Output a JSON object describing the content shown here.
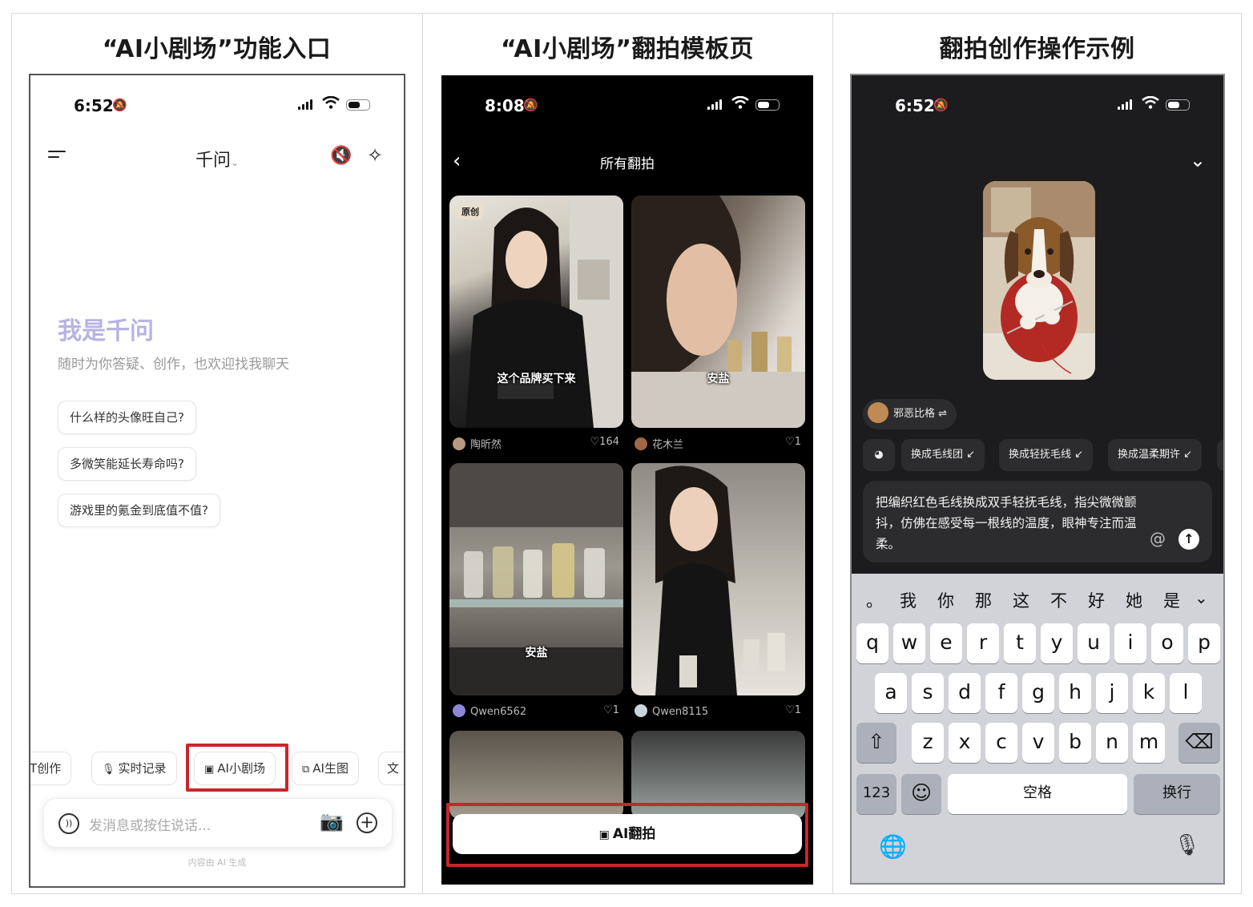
{
  "titles": [
    "“AI小剧场”功能入口",
    "“AI小剧场”翻拍模板页",
    "翻拍创作操作示例"
  ],
  "phone1": {
    "time": "6:52",
    "header_title": "千问",
    "greeting": "我是千问",
    "subtitle": "随时为你答疑、创作，也欢迎找我聊天",
    "suggestions": [
      "什么样的头像旺自己?",
      "多微笑能延长寿命吗?",
      "游戏里的氪金到底值不值?"
    ],
    "tools": [
      "PT创作",
      "实时记录",
      "AI小剧场",
      "AI生图"
    ],
    "input_placeholder": "发消息或按住说话...",
    "ai_generated_note": "内容由 AI 生成",
    "highlight_color": "#c8262c"
  },
  "phone2": {
    "time": "8:08",
    "header_title": "所有翻拍",
    "badge_original": "原创",
    "captions": [
      "这个品牌买下来",
      "安盐",
      "安盐"
    ],
    "tiles": [
      {
        "user": "陶昕然",
        "likes": "164"
      },
      {
        "user": "花木兰",
        "likes": "1"
      },
      {
        "user": "Qwen6562",
        "likes": "1"
      },
      {
        "user": "Qwen8115",
        "likes": "1"
      }
    ],
    "cta": "AI翻拍"
  },
  "phone3": {
    "time": "6:52",
    "style_name": "邪恶比格",
    "options": [
      "换成毛线团",
      "换成轻抚毛线",
      "换成温柔期许"
    ],
    "prompt": "把编织红色毛线换成双手轻抚毛线，指尖微微颤抖，仿佛在感受每一根线的温度，眼神专注而温柔。",
    "candidates": [
      "。",
      "我",
      "你",
      "那",
      "这",
      "不",
      "好",
      "她",
      "是"
    ],
    "row1": [
      "q",
      "w",
      "e",
      "r",
      "t",
      "y",
      "u",
      "i",
      "o",
      "p"
    ],
    "row2": [
      "a",
      "s",
      "d",
      "f",
      "g",
      "h",
      "j",
      "k",
      "l"
    ],
    "row3": [
      "z",
      "x",
      "c",
      "v",
      "b",
      "n",
      "m"
    ],
    "key_123": "123",
    "key_space": "空格",
    "key_return": "换行"
  }
}
